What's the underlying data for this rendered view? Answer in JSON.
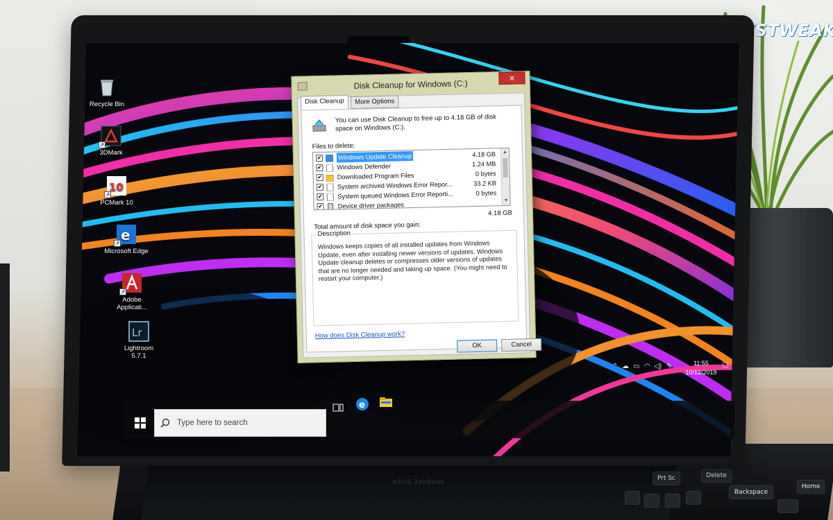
{
  "watermark": {
    "logo": "SYSTWEAK"
  },
  "desktop": {
    "icons": [
      {
        "label": "Recycle Bin",
        "icon": "recycle-bin-icon"
      },
      {
        "label": "3DMark",
        "icon": "3dmark-icon"
      },
      {
        "label": "PCMark 10",
        "icon": "pcmark-icon"
      },
      {
        "label": "Microsoft Edge",
        "icon": "edge-icon"
      },
      {
        "label": "Adobe Applicati...",
        "icon": "adobe-icon"
      },
      {
        "label": "Lightroom 5.7.1",
        "icon": "lightroom-icon"
      }
    ]
  },
  "taskbar": {
    "search_placeholder": "Type here to search",
    "clock_time": "11:55",
    "clock_date": "10/12/2019",
    "pinned": [
      "task-view-icon",
      "edge-icon",
      "file-explorer-icon"
    ]
  },
  "dialog": {
    "title": "Disk Cleanup for Windows (C:)",
    "close_label": "✕",
    "tabs": [
      {
        "label": "Disk Cleanup",
        "active": true
      },
      {
        "label": "More Options",
        "active": false
      }
    ],
    "hint": "You can use Disk Cleanup to free up to 4.18 GB of disk space on Windows (C:).",
    "files_label": "Files to delete:",
    "files": [
      {
        "name": "Windows Update Cleanup",
        "size": "4.18 GB",
        "checked": true,
        "selected": true,
        "icon": "windows-update-icon"
      },
      {
        "name": "Windows Defender",
        "size": "1.24 MB",
        "checked": true,
        "selected": false,
        "icon": "file-icon"
      },
      {
        "name": "Downloaded Program Files",
        "size": "0 bytes",
        "checked": true,
        "selected": false,
        "icon": "folder-icon"
      },
      {
        "name": "System archived Windows Error Repor...",
        "size": "33.2 KB",
        "checked": true,
        "selected": false,
        "icon": "file-icon"
      },
      {
        "name": "System queued Windows Error Reporti...",
        "size": "0 bytes",
        "checked": true,
        "selected": false,
        "icon": "file-icon"
      },
      {
        "name": "Device driver packages",
        "size": "",
        "checked": true,
        "selected": false,
        "icon": "driver-icon"
      }
    ],
    "total_label": "Total amount of disk space you gain:",
    "total_value": "4.18 GB",
    "description_legend": "Description",
    "description": "Windows keeps copies of all installed updates from Windows Update, even after installing newer versions of updates. Windows Update cleanup deletes or compresses older versions of updates that are no longer needed and taking up space. (You might need to restart your computer.)",
    "help_link": "How does Disk Cleanup work?",
    "ok_label": "OK",
    "cancel_label": "Cancel"
  },
  "keyboard": {
    "keys": [
      "Prt Sc",
      "Delete",
      "Backspace",
      "Home"
    ]
  },
  "colors": {
    "selection": "#3399ff",
    "close_button": "#c7302b",
    "dialog_frame": "#d6d9ad",
    "link": "#1a55c4",
    "logo_blue": "#1677c9"
  }
}
